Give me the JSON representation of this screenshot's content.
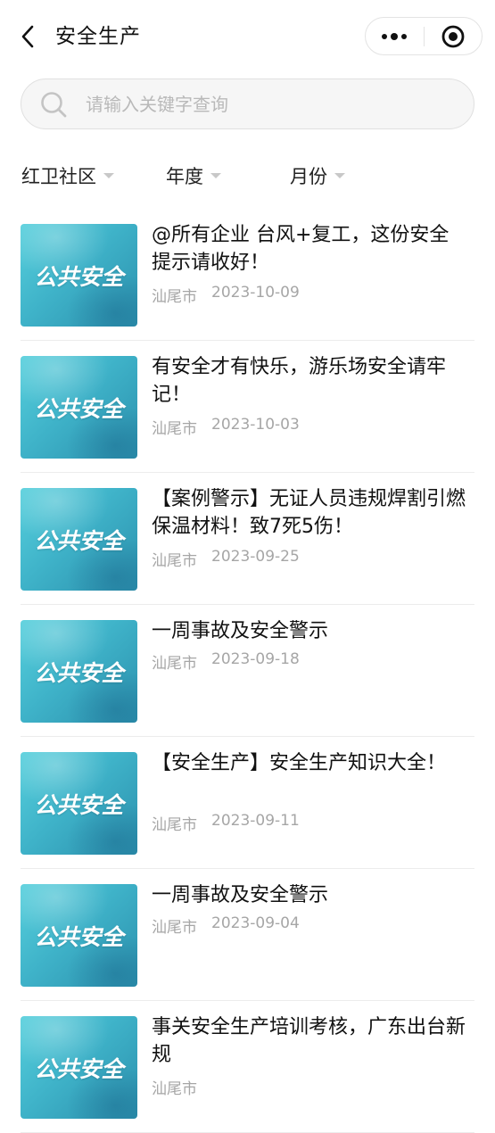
{
  "header": {
    "title": "安全生产",
    "back_icon": "back-arrow-icon",
    "menu_icon": "more-dots-icon",
    "close_icon": "target-close-icon"
  },
  "search": {
    "placeholder": "请输入关键字查询",
    "value": ""
  },
  "filters": [
    {
      "label": "红卫社区"
    },
    {
      "label": "年度"
    },
    {
      "label": "月份"
    }
  ],
  "thumbnail_text": "公共安全",
  "articles": [
    {
      "title": "@所有企业 台风+复工，这份安全提示请收好！",
      "source": "汕尾市",
      "date": "2023-10-09"
    },
    {
      "title": "有安全才有快乐，游乐场安全请牢记！",
      "source": "汕尾市",
      "date": "2023-10-03"
    },
    {
      "title": "【案例警示】无证人员违规焊割引燃保温材料！致7死5伤！",
      "source": "汕尾市",
      "date": "2023-09-25"
    },
    {
      "title": "一周事故及安全警示",
      "source": "汕尾市",
      "date": "2023-09-18"
    },
    {
      "title": "【安全生产】安全生产知识大全！",
      "source": "汕尾市",
      "date": "2023-09-11"
    },
    {
      "title": "一周事故及安全警示",
      "source": "汕尾市",
      "date": "2023-09-04"
    },
    {
      "title": "事关安全生产培训考核，广东出台新规",
      "source": "汕尾市",
      "date": ""
    }
  ],
  "colors": {
    "thumbnail_gradient_start": "#56cfdc",
    "thumbnail_gradient_end": "#2b90ad",
    "meta_text": "#a6a6a6",
    "divider": "#ececec"
  }
}
